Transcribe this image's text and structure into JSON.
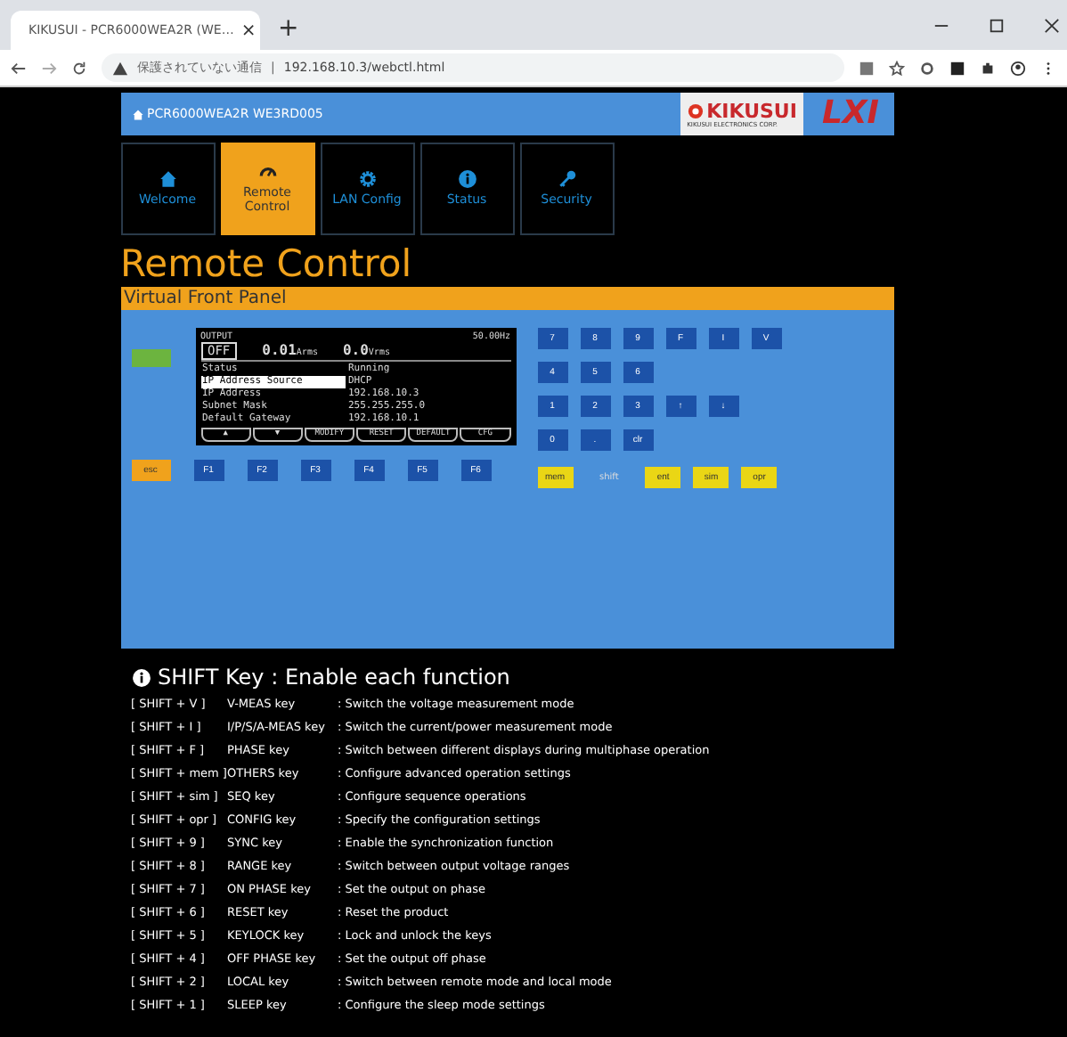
{
  "browser": {
    "tab_title": "KIKUSUI - PCR6000WEA2R (WE…",
    "tab_close": "×",
    "new_tab": "+",
    "security_warning": "保護されていない通信",
    "separator": "|",
    "url": "192.168.10.3/webctl.html"
  },
  "header": {
    "device_name": "PCR6000WEA2R WE3RD005",
    "logo_text": "KIKUSUI",
    "logo_subtext": "KIKUSUI ELECTRONICS CORP.",
    "lxi": "LXI"
  },
  "nav": [
    {
      "label": "Welcome",
      "kind": "home",
      "selected": false
    },
    {
      "label": "Remote Control",
      "kind": "gauge",
      "selected": true
    },
    {
      "label": "LAN Config",
      "kind": "gear",
      "selected": false
    },
    {
      "label": "Status",
      "kind": "info",
      "selected": false
    },
    {
      "label": "Security",
      "kind": "key",
      "selected": false
    }
  ],
  "page_title": "Remote Control",
  "panel_title": "Virtual Front Panel",
  "display": {
    "output_label": "OUTPUT",
    "output_state": "OFF",
    "current": "0.01",
    "current_unit": "Arms",
    "voltage": "0.0",
    "voltage_unit": "Vrms",
    "frequency": "50.00Hz",
    "rows": [
      {
        "label": "Status",
        "value": "Running",
        "selected": false
      },
      {
        "label": "IP Address Source",
        "value": "DHCP",
        "selected": true
      },
      {
        "label": "IP Address",
        "value": "192.168.10.3",
        "selected": false
      },
      {
        "label": "Subnet Mask",
        "value": "255.255.255.0",
        "selected": false
      },
      {
        "label": "Default Gateway",
        "value": "192.168.10.1",
        "selected": false
      }
    ],
    "softkeys": [
      "▲",
      "▼",
      "MODIFY",
      "RESET",
      "DEFAULT",
      "CFG"
    ]
  },
  "esc_key": "esc",
  "function_keys": [
    "F1",
    "F2",
    "F3",
    "F4",
    "F5",
    "F6"
  ],
  "keypad": [
    [
      "7",
      "8",
      "9",
      "F",
      "I",
      "V"
    ],
    [
      "4",
      "5",
      "6"
    ],
    [
      "1",
      "2",
      "3",
      "↑",
      "↓"
    ],
    [
      "0",
      ".",
      "clr"
    ]
  ],
  "bottom_keys": [
    {
      "label": "mem",
      "kind": "key"
    },
    {
      "label": "shift",
      "kind": "text"
    },
    {
      "label": "ent",
      "kind": "key"
    },
    {
      "label": "sim",
      "kind": "key"
    },
    {
      "label": "opr",
      "kind": "key"
    }
  ],
  "shift_section": {
    "title": "SHIFT Key : Enable each function",
    "rows": [
      [
        "[ SHIFT + V ]",
        "V-MEAS key",
        ": Switch the voltage measurement mode"
      ],
      [
        "[ SHIFT + I ]",
        "I/P/S/A-MEAS key",
        ": Switch the current/power measurement mode"
      ],
      [
        "[ SHIFT + F ]",
        "PHASE key",
        ": Switch between different displays during multiphase operation"
      ],
      [
        "[ SHIFT + mem ]",
        "OTHERS key",
        ": Configure advanced operation settings"
      ],
      [
        "[ SHIFT + sim ]",
        "SEQ key",
        ": Configure sequence operations"
      ],
      [
        "[ SHIFT + opr ]",
        "CONFIG key",
        ": Specify the configuration settings"
      ],
      [
        "[ SHIFT + 9 ]",
        "SYNC key",
        ": Enable the synchronization function"
      ],
      [
        "[ SHIFT + 8 ]",
        "RANGE key",
        ": Switch between output voltage ranges"
      ],
      [
        "[ SHIFT + 7 ]",
        "ON PHASE key",
        ": Set the output on phase"
      ],
      [
        "[ SHIFT + 6 ]",
        "RESET key",
        ": Reset the product"
      ],
      [
        "[ SHIFT + 5 ]",
        "KEYLOCK key",
        ": Lock and unlock the keys"
      ],
      [
        "[ SHIFT + 4 ]",
        "OFF PHASE key",
        ": Set the output off phase"
      ],
      [
        "[ SHIFT + 2 ]",
        "LOCAL key",
        ": Switch between remote mode and local mode"
      ],
      [
        "[ SHIFT + 1 ]",
        "SLEEP key",
        ": Configure the sleep mode settings"
      ]
    ]
  }
}
